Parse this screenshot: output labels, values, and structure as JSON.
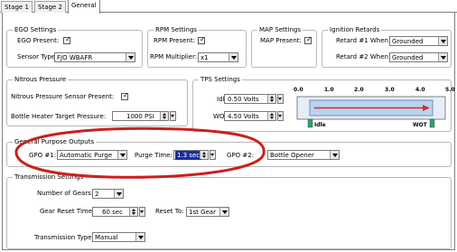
{
  "tabs": [
    "Stage 1",
    "Stage 2",
    "General"
  ],
  "ego_settings": {
    "title": "EGO Settings",
    "ego_present_label": "EGO Present:",
    "ego_present_checked": true,
    "sensor_type_label": "Sensor Type:",
    "sensor_type_value": "FJO WBAFR"
  },
  "rpm_settings": {
    "title": "RPM Settings",
    "rpm_present_label": "RPM Present:",
    "rpm_present_checked": true,
    "rpm_multiplier_label": "RPM Multiplier:",
    "rpm_multiplier_value": "x1"
  },
  "map_settings": {
    "title": "MAP Settings",
    "map_present_label": "MAP Present:",
    "map_present_checked": true
  },
  "ignition_retards": {
    "title": "Ignition Retards",
    "retard1_label": "Retard #1 When:",
    "retard1_value": "Grounded",
    "retard2_label": "Retard #2 When:",
    "retard2_value": "Grounded"
  },
  "nitrous_pressure": {
    "title": "Nitrous Pressure",
    "sensor_present_label": "Nitrous Pressure Sensor Present:",
    "sensor_present_checked": true,
    "bottle_heater_label": "Bottle Heater Target Pressure:",
    "bottle_heater_value": "1000 PSI"
  },
  "tps_settings": {
    "title": "TPS Settings",
    "idle_label": "Idle:",
    "idle_value": "0.50 Volts",
    "wot_label": "WOT:",
    "wot_value": "4.50 Volts",
    "scale_ticks": [
      "0.0",
      "1.0",
      "2.0",
      "3.0",
      "4.0",
      "5.0"
    ],
    "marker_idle_label": "Idle",
    "marker_wot_label": "WOT"
  },
  "general_purpose_outputs": {
    "title": "General Purpose Outputs",
    "gpo1_label": "GPO #1:",
    "gpo1_value": "Automatic Purge",
    "purge_time_label": "Purge Time:",
    "purge_time_value": "1.3 sec",
    "gpo2_label": "GPO #2:",
    "gpo2_value": "Bottle Opener"
  },
  "transmission_settings": {
    "title": "Transmission Settings",
    "num_gears_label": "Number of Gears:",
    "num_gears_value": "2",
    "gear_reset_time_label": "Gear Reset Time:",
    "gear_reset_time_value": "60 sec",
    "reset_to_label": "Reset To:",
    "reset_to_value": "1st Gear",
    "transmission_type_label": "Transmission Type:",
    "transmission_type_value": "Manual"
  },
  "colors": {
    "highlight_ellipse": "#cc1f1f",
    "selection_blue": "#1a2f9c",
    "tps_bar_fill": "#b9d3ef",
    "tps_arrow": "#d03030",
    "tps_marker": "#3a9a6a"
  }
}
